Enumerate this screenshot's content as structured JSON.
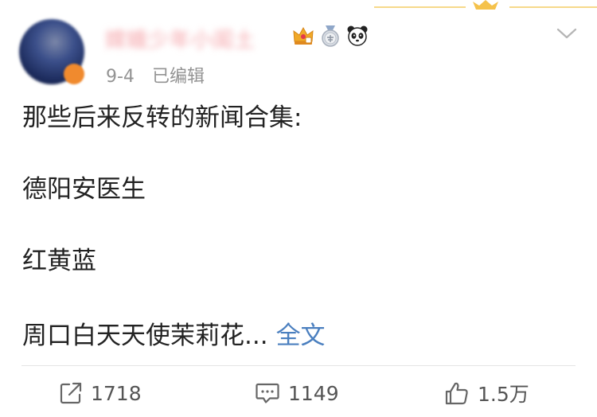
{
  "post": {
    "username": "嫦娥少年小闺土",
    "meta": {
      "date": "9-4",
      "edited_label": "已编辑"
    },
    "content": {
      "lines": [
        "那些后来反转的新闻合集:",
        "德阳安医生",
        "红黄蓝",
        "周口白天天使茉莉花..."
      ],
      "full_text_link": "全文"
    },
    "badges": [
      "crown-badge-icon",
      "medal-badge-icon",
      "panda-badge-icon"
    ]
  },
  "actions": {
    "forward_count": "1718",
    "comment_count": "1149",
    "like_count": "1.5万"
  },
  "colors": {
    "link": "#4a7fbf",
    "meta_text": "#939393",
    "body_text": "#222222",
    "divider": "#e4e4e4",
    "accent_gold": "#f5c24b"
  }
}
